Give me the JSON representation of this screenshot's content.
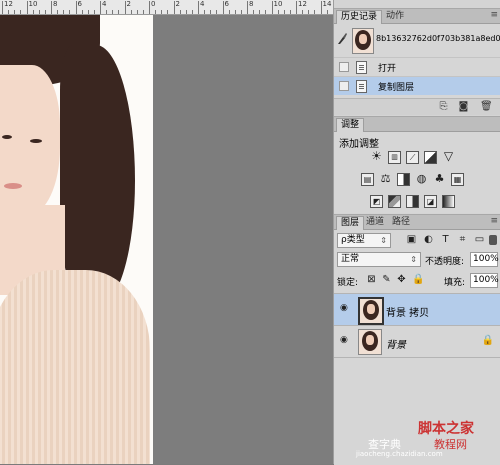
{
  "ruler": {
    "labels": [
      "12",
      "10",
      "8",
      "6",
      "4",
      "2",
      "0",
      "2",
      "4",
      "6",
      "8",
      "10",
      "12",
      "14"
    ]
  },
  "history_panel": {
    "tabs": [
      "历史记录",
      "动作"
    ],
    "snapshot_name": "8b13632762d0f703b381a8ed0...",
    "states": [
      {
        "label": "打开",
        "selected": false
      },
      {
        "label": "复制图层",
        "selected": true
      }
    ]
  },
  "adjustments_panel": {
    "tab": "调整",
    "title": "添加调整"
  },
  "layers_panel": {
    "tabs": [
      "图层",
      "通道",
      "路径"
    ],
    "filter_kind": "ρ类型",
    "blend_mode": "正常",
    "opacity_label": "不透明度:",
    "opacity_value": "100%",
    "lock_label": "锁定:",
    "fill_label": "填充:",
    "fill_value": "100%",
    "layers": [
      {
        "name": "背景 拷贝",
        "selected": true,
        "locked": false
      },
      {
        "name": "背景",
        "selected": false,
        "locked": true
      }
    ]
  },
  "watermark": {
    "line1": "脚本之家",
    "line2": "教程网",
    "line3": "jiaocheng.chazidian.com",
    "line4": "查字典"
  },
  "colors": {
    "selection": "#b4ccea",
    "workspace": "#7d7d7d",
    "panel": "#d6d6d6"
  }
}
